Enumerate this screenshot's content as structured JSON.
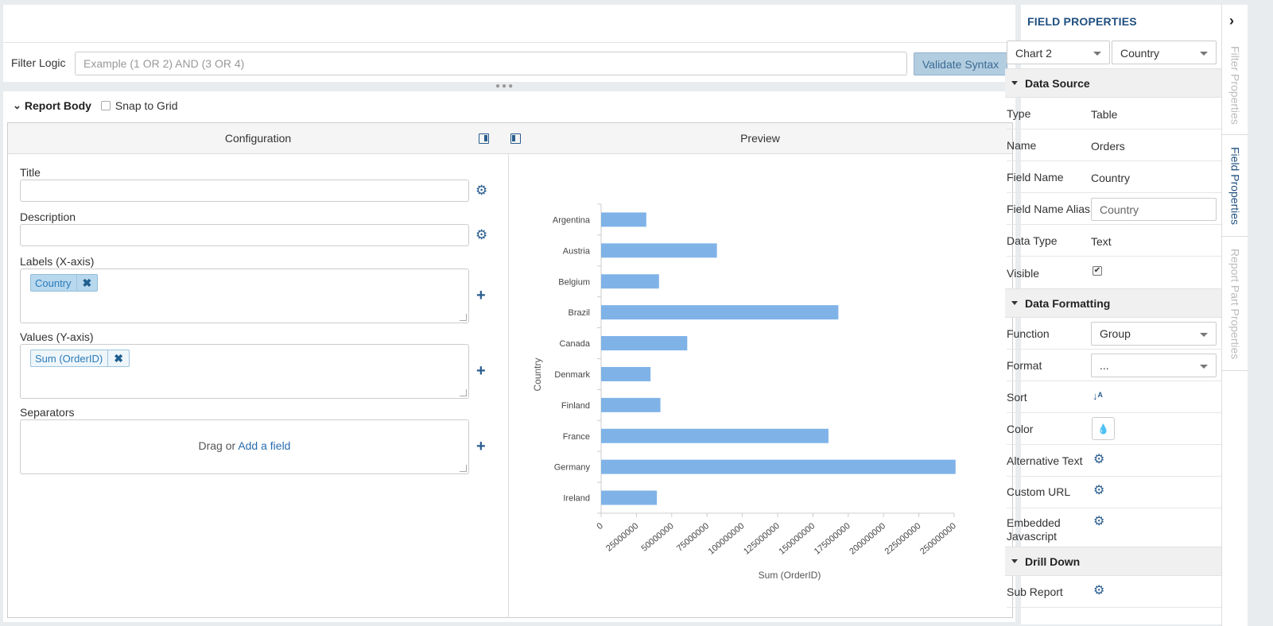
{
  "filter": {
    "label": "Filter Logic",
    "placeholder": "Example (1 OR 2) AND (3 OR 4)",
    "validate_label": "Validate Syntax"
  },
  "report_body": {
    "title": "Report Body",
    "snap_label": "Snap to Grid"
  },
  "configuration": {
    "header": "Configuration",
    "title_label": "Title",
    "description_label": "Description",
    "labels_label": "Labels (X-axis)",
    "labels_chip": "Country",
    "values_label": "Values (Y-axis)",
    "values_chip": "Sum (OrderID)",
    "separators_label": "Separators",
    "drag_text": "Drag or ",
    "add_field_link": "Add a field"
  },
  "preview": {
    "header": "Preview"
  },
  "chart_data": {
    "type": "bar",
    "orientation": "horizontal",
    "categories": [
      "Argentina",
      "Austria",
      "Belgium",
      "Brazil",
      "Canada",
      "Denmark",
      "Finland",
      "France",
      "Germany",
      "Ireland"
    ],
    "values": [
      32000000,
      82000000,
      41000000,
      168000000,
      61000000,
      35000000,
      42000000,
      161000000,
      251000000,
      39500000
    ],
    "xlabel": "Sum (OrderID)",
    "ylabel": "Country",
    "xlim": [
      0,
      250000000
    ],
    "ticks": [
      "0",
      "25000000",
      "50000000",
      "75000000",
      "100000000",
      "125000000",
      "150000000",
      "175000000",
      "200000000",
      "225000000",
      "250000000"
    ],
    "bar_color": "#7fb3e8",
    "grid": false
  },
  "field_properties": {
    "title": "FIELD PROPERTIES",
    "chart_select": "Chart 2",
    "field_select": "Country",
    "data_source": {
      "header": "Data Source",
      "type_label": "Type",
      "type_value": "Table",
      "name_label": "Name",
      "name_value": "Orders",
      "field_name_label": "Field Name",
      "field_name_value": "Country",
      "alias_label": "Field Name Alias",
      "alias_value": "Country",
      "data_type_label": "Data Type",
      "data_type_value": "Text",
      "visible_label": "Visible"
    },
    "data_formatting": {
      "header": "Data Formatting",
      "function_label": "Function",
      "function_value": "Group",
      "format_label": "Format",
      "format_value": "...",
      "sort_label": "Sort",
      "color_label": "Color",
      "alt_text_label": "Alternative Text",
      "custom_url_label": "Custom URL",
      "embedded_js_label": "Embedded Javascript"
    },
    "drill_down": {
      "header": "Drill Down",
      "sub_report_label": "Sub Report"
    }
  },
  "side_tabs": {
    "filter": "Filter Properties",
    "field": "Field Properties",
    "report_part": "Report Part Properties"
  }
}
